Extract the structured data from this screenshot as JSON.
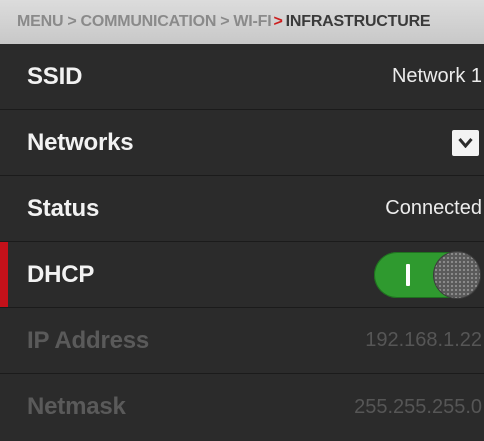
{
  "breadcrumb": {
    "items": [
      "MENU",
      "COMMUNICATION",
      "WI-FI"
    ],
    "current": "INFRASTRUCTURE",
    "separator": ">"
  },
  "rows": {
    "ssid": {
      "label": "SSID",
      "value": "Network 1"
    },
    "networks": {
      "label": "Networks",
      "control": "dropdown"
    },
    "status": {
      "label": "Status",
      "value": "Connected"
    },
    "dhcp": {
      "label": "DHCP",
      "toggle_state": "on"
    },
    "ip_address": {
      "label": "IP Address",
      "value": "192.168.1.22"
    },
    "netmask": {
      "label": "Netmask",
      "value": "255.255.255.0"
    }
  },
  "colors": {
    "accent": "#c4111a",
    "toggle_on": "#2f9a2f",
    "background": "#2b2b2b"
  },
  "icons": {
    "dropdown": "chevron-down-icon",
    "separator": "chevron-right-icon"
  }
}
